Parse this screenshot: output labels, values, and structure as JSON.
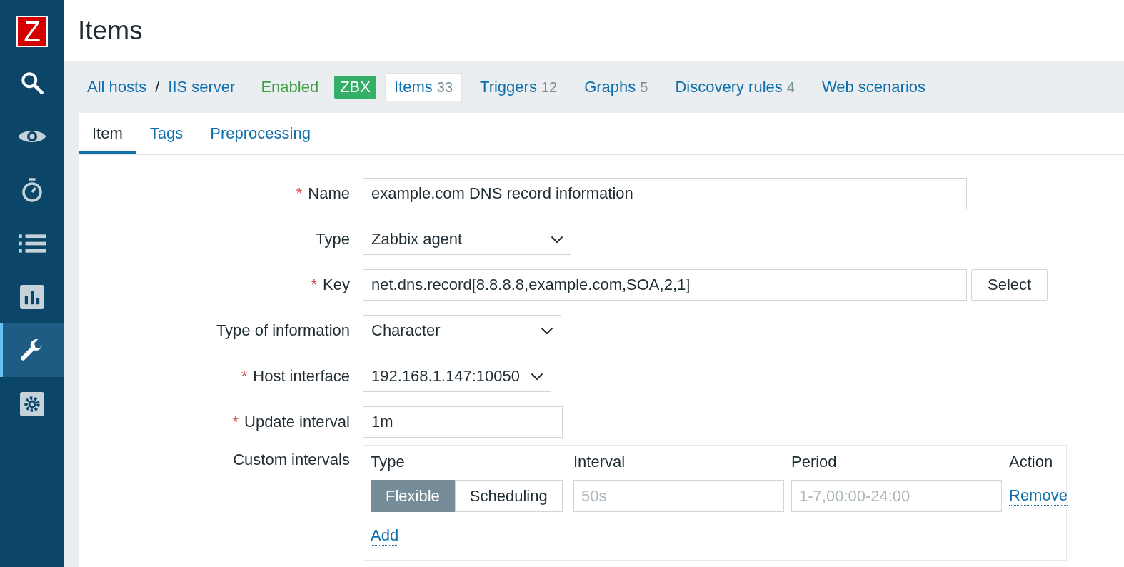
{
  "sidebar": {
    "logo": "Z",
    "items": [
      {
        "kind": "search",
        "selected": false
      },
      {
        "kind": "eye",
        "selected": false
      },
      {
        "kind": "timer",
        "selected": false
      },
      {
        "kind": "list",
        "selected": false
      },
      {
        "kind": "chart",
        "selected": false
      },
      {
        "kind": "wrench",
        "selected": true
      },
      {
        "kind": "gear",
        "selected": false
      }
    ]
  },
  "page_title": "Items",
  "breadcrumbs": {
    "items": [
      "All hosts",
      "IIS server"
    ],
    "separator": "/"
  },
  "status": "Enabled",
  "badge": "ZBX",
  "host_tabs": [
    {
      "label": "Items",
      "count": "33",
      "selected": true
    },
    {
      "label": "Triggers",
      "count": "12",
      "selected": false
    },
    {
      "label": "Graphs",
      "count": "5",
      "selected": false
    },
    {
      "label": "Discovery rules",
      "count": "4",
      "selected": false
    },
    {
      "label": "Web scenarios",
      "selected": false
    }
  ],
  "form_tabs": [
    {
      "label": "Item",
      "selected": true
    },
    {
      "label": "Tags",
      "selected": false
    },
    {
      "label": "Preprocessing",
      "selected": false
    }
  ],
  "required_mark": "*",
  "fields": [
    {
      "label": "Name",
      "required": true,
      "kind": "text",
      "value": "example.com DNS record information"
    },
    {
      "label": "Type",
      "required": false,
      "kind": "select",
      "value": "Zabbix agent"
    },
    {
      "label": "Key",
      "required": true,
      "kind": "text",
      "value": "net.dns.record[8.8.8.8,example.com,SOA,2,1]",
      "button": "Select"
    },
    {
      "label": "Type of information",
      "required": false,
      "kind": "select",
      "value": "Character"
    },
    {
      "label": "Host interface",
      "required": true,
      "kind": "select",
      "value": "192.168.1.147:10050"
    },
    {
      "label": "Update interval",
      "required": true,
      "kind": "text",
      "value": "1m"
    }
  ],
  "custom_intervals": {
    "label": "Custom intervals",
    "columns": [
      "Type",
      "Interval",
      "Period",
      "Action"
    ],
    "rows": [
      {
        "modes": [
          {
            "label": "Flexible",
            "selected": true
          },
          {
            "label": "Scheduling",
            "selected": false
          }
        ],
        "interval_placeholder": "50s",
        "period_placeholder": "1-7,00:00-24:00",
        "action": "Remove"
      }
    ],
    "add": "Add"
  }
}
